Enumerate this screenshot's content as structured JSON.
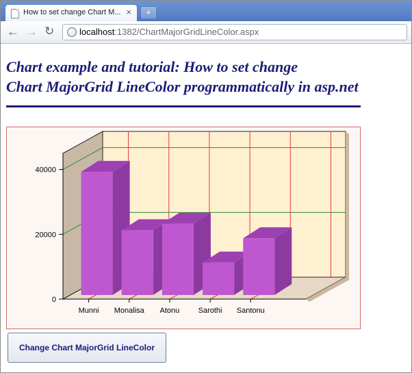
{
  "browser": {
    "tab_title": "How to set change Chart M...",
    "tab_close": "×",
    "new_tab": "+",
    "back": "←",
    "forward": "→",
    "reload": "↻",
    "url_host": "localhost",
    "url_rest": ":1382/ChartMajorGridLineColor.aspx"
  },
  "page": {
    "heading_line1": "Chart example and tutorial: How to set change",
    "heading_line2": "Chart MajorGrid LineColor programmatically in asp.net",
    "button_label": "Change Chart MajorGrid LineColor"
  },
  "colors": {
    "heading": "#1c1c78",
    "bar_front": "#bf57d0",
    "bar_top": "#9d40b4",
    "bar_side": "#8c3aa0",
    "major_grid_y": "#2e8b2e",
    "major_grid_x": "#e03b3b",
    "wall_back": "#fff0d2",
    "wall_left": "#c8b9a6",
    "floor": "#e7d9c6"
  },
  "chart_data": {
    "type": "bar",
    "style": "3d-column",
    "categories": [
      "Munni",
      "Monalisa",
      "Atonu",
      "Sarothi",
      "Santonu"
    ],
    "values": [
      38000,
      20000,
      22000,
      10000,
      17500
    ],
    "ylim": [
      0,
      45000
    ],
    "yticks": [
      0,
      20000,
      40000
    ],
    "ytick_labels": [
      "0",
      "20000",
      "40000"
    ],
    "title": "",
    "xlabel": "",
    "ylabel": "",
    "grid": true,
    "legend": false
  }
}
